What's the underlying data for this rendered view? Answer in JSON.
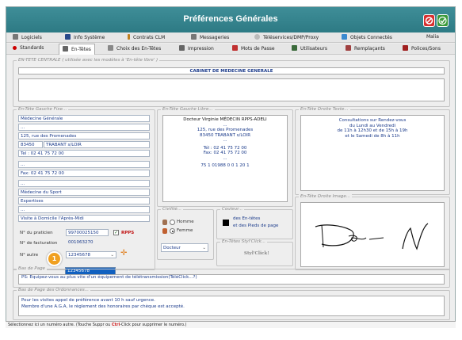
{
  "window": {
    "title": "Préférences Générales"
  },
  "tabs_row1": [
    {
      "label": "Logiciels",
      "color": "#555"
    },
    {
      "label": "Info Système",
      "color": "#2a4a8a"
    },
    {
      "label": "Contrats CLM",
      "color": "#c08020"
    },
    {
      "label": "Messageries",
      "color": "#666"
    },
    {
      "label": "Téléservices/DMP/Proxy",
      "color": "#999"
    },
    {
      "label": "Objets Connectés",
      "color": "#3a8ad0"
    },
    {
      "label": "Malia",
      "color": "#888"
    }
  ],
  "tabs_row2": [
    {
      "label": "Standards",
      "color": "#c00"
    },
    {
      "label": "En-Têtes",
      "color": "#555"
    },
    {
      "label": "Choix des En-Têtes",
      "color": "#666"
    },
    {
      "label": "Impression",
      "color": "#555"
    },
    {
      "label": "Mots de Passe",
      "color": "#c03030"
    },
    {
      "label": "Utilisateurs",
      "color": "#3a6a3a"
    },
    {
      "label": "Remplaçants",
      "color": "#a04040"
    },
    {
      "label": "Polices/Sons",
      "color": "#a02020"
    }
  ],
  "entete_centrale": {
    "legend": "EN-TETE CENTRALE  ( utilisée avec les modèles à 'En-tête libre' )",
    "line1": "CABINET DE MEDECINE GENERALE"
  },
  "gauche_fixe": {
    "legend": "En-Tête Gauche Fixe...",
    "lines": [
      "Médecine Générale",
      "...",
      "125, rue des Promenades",
      "83450",
      "TRABANT s/LOIR",
      "Tel : 02 41 75 72 00",
      "...",
      "Fax: 02 41 75 72 00",
      "...",
      "Médecine du Sport",
      "Expertises",
      "...",
      "Visite à Domicile l'Après-Midi"
    ],
    "praticien_label": "N° du praticien",
    "praticien_value": "99700025150",
    "rpps_label": "RPPS",
    "facturation_label": "N° de facturation",
    "facturation_value": "001063270",
    "autre_label": "N° autre",
    "autre_value": "12345678",
    "dropdown_option": "12345678",
    "badge": "1"
  },
  "gauche_libre": {
    "legend": "En-Tête Gauche Libre...",
    "lines": [
      "Docteur  Virginie MÉDECIN RPPS-ADELI",
      "...",
      "125, rue des Promenades",
      "83450  TRABANT s/LOIR",
      "...",
      "Tél : 02 41 75 72 00",
      "Fax: 02 41 75 72 00",
      "...",
      "75 1 01988  0  0 1 20 1"
    ]
  },
  "droite_texte": {
    "legend": "En-Tête Droite Texte...",
    "lines": [
      "Consultations sur Rendez-vous",
      "du Lundi  au Vendredi",
      "de 11h à 12h30 et de 15h à 19h",
      "et le Samedi de 8h à 11h"
    ]
  },
  "civilite": {
    "legend": "Civilité...",
    "homme": "Homme",
    "femme": "Femme",
    "select": "Docteur"
  },
  "couleur": {
    "legend": "Couleur...",
    "text1": "des En-têtes",
    "text2": "et des Pieds de page"
  },
  "stylclick": {
    "legend": "En-Têtes Styl'Click...",
    "label": "Styl'Click!"
  },
  "droite_image": {
    "legend": "En-Tête Droite Image..."
  },
  "bas_page": {
    "legend": "Bas de Page",
    "text": "PS: Equipez-vous au plus vite d'un équipement de télétransmission(TéléClick...?)"
  },
  "bas_ordonnances": {
    "legend": "Bas de Page des Ordonnances...",
    "line1": "Pour les visites appel de préférence avant 10 h sauf urgence.",
    "line2": "Membre d'une A.G.A, le règlement des honoraires par chèque est accepté."
  },
  "status": {
    "pre": "Sélectionnez ici un numéro autre. (Touche Suppr ou ",
    "ctrl": "Ctrl",
    "post": "-Click pour supprimer le numéro.)"
  }
}
